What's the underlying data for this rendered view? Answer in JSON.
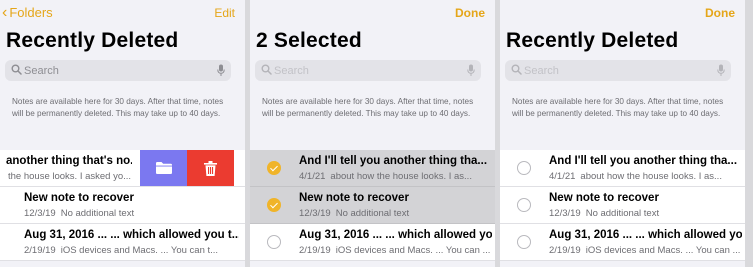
{
  "colors": {
    "accent": "#e5a619",
    "selected_check": "#f0b429",
    "move_action": "#7b78f0",
    "delete_action": "#eb3b30"
  },
  "panel1": {
    "back_label": "Folders",
    "edit_label": "Edit",
    "title": "Recently Deleted",
    "search_placeholder": "Search",
    "info": "Notes are available here for 30 days. After that time, notes will be permanently deleted. This may take up to 40 days.",
    "rows": [
      {
        "title": "another thing that's no...",
        "date": "",
        "preview": "the house looks. I asked yo..."
      },
      {
        "title": "New note to recover",
        "date": "12/3/19",
        "preview": "No additional text"
      },
      {
        "title": "Aug 31, 2016 ... ... which allowed you t...",
        "date": "2/19/19",
        "preview": "iOS devices and Macs. ... You can t..."
      }
    ],
    "swipe_actions": {
      "move_icon": "folder-icon",
      "delete_icon": "trash-icon"
    }
  },
  "panel2": {
    "done_label": "Done",
    "title": "2 Selected",
    "search_placeholder": "Search",
    "info": "Notes are available here for 30 days. After that time, notes will be permanently deleted. This may take up to 40 days.",
    "rows": [
      {
        "title": "And I'll tell you another thing tha...",
        "date": "4/1/21",
        "preview": "about how the house looks. I as...",
        "selected": true
      },
      {
        "title": "New note to recover",
        "date": "12/3/19",
        "preview": "No additional text",
        "selected": true
      },
      {
        "title": "Aug 31, 2016 ... ... which allowed yo...",
        "date": "2/19/19",
        "preview": "iOS devices and Macs. ... You can ...",
        "selected": false
      }
    ]
  },
  "panel3": {
    "done_label": "Done",
    "title": "Recently Deleted",
    "search_placeholder": "Search",
    "info": "Notes are available here for 30 days. After that time, notes will be permanently deleted. This may take up to 40 days.",
    "rows": [
      {
        "title": "And I'll tell you another thing tha...",
        "date": "4/1/21",
        "preview": "about how the house looks. I as...",
        "selected": false
      },
      {
        "title": "New note to recover",
        "date": "12/3/19",
        "preview": "No additional text",
        "selected": false
      },
      {
        "title": "Aug 31, 2016 ... ... which allowed yo...",
        "date": "2/19/19",
        "preview": "iOS devices and Macs. ... You can ...",
        "selected": false
      }
    ]
  }
}
